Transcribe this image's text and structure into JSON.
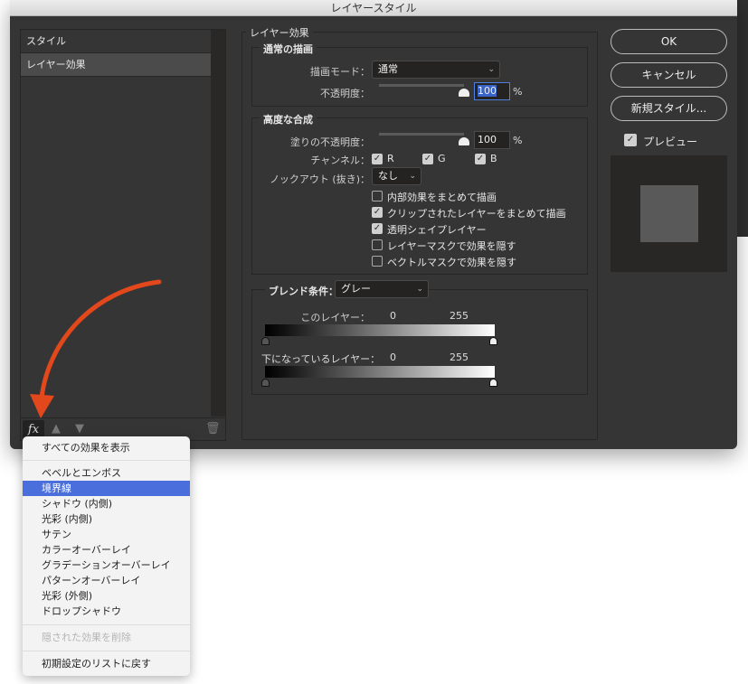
{
  "window": {
    "title": "レイヤースタイル"
  },
  "left_panel": {
    "items": [
      {
        "label": "スタイル"
      },
      {
        "label": "レイヤー効果",
        "selected": true
      }
    ],
    "fx_label": "fx",
    "icons": [
      "move-up-icon",
      "move-down-icon",
      "trash-icon"
    ]
  },
  "main": {
    "title": "レイヤー効果",
    "normal": {
      "title": "通常の描画",
      "blend_mode_label": "描画モード：",
      "blend_mode": "通常",
      "opacity_label": "不透明度：",
      "opacity": "100",
      "percent": "%"
    },
    "advanced": {
      "title": "高度な合成",
      "fill_label": "塗りの不透明度：",
      "fill": "100",
      "percent": "%",
      "channel_label": "チャンネル：",
      "channels": [
        {
          "label": "R",
          "checked": true
        },
        {
          "label": "G",
          "checked": true
        },
        {
          "label": "B",
          "checked": true
        }
      ],
      "knockout_label": "ノックアウト (抜き)：",
      "knockout": "なし",
      "options": [
        {
          "label": "内部効果をまとめて描画",
          "checked": false
        },
        {
          "label": "クリップされたレイヤーをまとめて描画",
          "checked": true
        },
        {
          "label": "透明シェイプレイヤー",
          "checked": true
        },
        {
          "label": "レイヤーマスクで効果を隠す",
          "checked": false
        },
        {
          "label": "ベクトルマスクで効果を隠す",
          "checked": false
        }
      ]
    },
    "blend_if": {
      "label": "ブレンド条件：",
      "value": "グレー",
      "this_layer": {
        "label": "このレイヤー：",
        "min": "0",
        "max": "255"
      },
      "underlying": {
        "label": "下になっているレイヤー：",
        "min": "0",
        "max": "255"
      }
    }
  },
  "buttons": {
    "ok": "OK",
    "cancel": "キャンセル",
    "new_style": "新規スタイル...",
    "preview_label": "プレビュー",
    "preview_checked": true
  },
  "menu": {
    "items": [
      {
        "label": "すべての効果を表示"
      },
      {
        "label": "ベベルとエンボス"
      },
      {
        "label": "境界線",
        "highlighted": true
      },
      {
        "label": "シャドウ (内側)"
      },
      {
        "label": "光彩 (内側)"
      },
      {
        "label": "サテン"
      },
      {
        "label": "カラーオーバーレイ"
      },
      {
        "label": "グラデーションオーバーレイ"
      },
      {
        "label": "パターンオーバーレイ"
      },
      {
        "label": "光彩 (外側)"
      },
      {
        "label": "ドロップシャドウ"
      },
      {
        "label": "隠された効果を削除",
        "disabled": true
      },
      {
        "label": "初期設定のリストに戻す"
      }
    ]
  },
  "colors": {
    "accent_highlight": "#4a6fdc",
    "annotation_arrow": "#e2481c",
    "dialog_bg": "#353535"
  }
}
